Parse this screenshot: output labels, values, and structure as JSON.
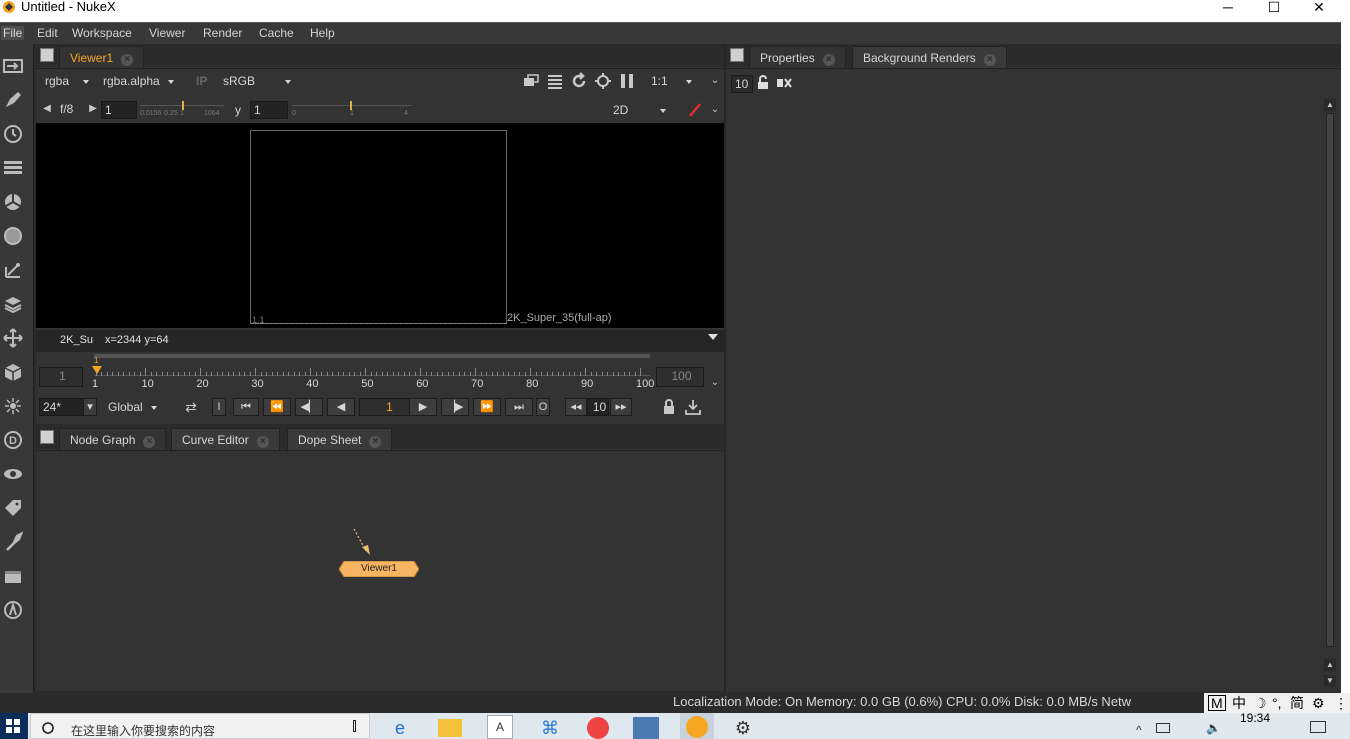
{
  "window": {
    "title": "Untitled - NukeX",
    "minimize": "─",
    "maximize": "☐",
    "close": "✕"
  },
  "menu": [
    "File",
    "Edit",
    "Workspace",
    "Viewer",
    "Render",
    "Cache",
    "Help"
  ],
  "toolbar_icons": [
    "image-icon",
    "draw-icon",
    "time-icon",
    "channel-icon",
    "color-icon",
    "filter-icon",
    "keyer-icon",
    "merge-icon",
    "transform-icon",
    "3d-icon",
    "particles-icon",
    "deep-icon",
    "views-icon",
    "metadata-icon",
    "toolsets-icon",
    "other-icon",
    "furnace-icon"
  ],
  "viewer_panel": {
    "tab": "Viewer1",
    "channels": "rgba",
    "alpha": "rgba.alpha",
    "ip": "IP",
    "lut": "sRGB",
    "zoom": "1:1",
    "fstop": "f/8",
    "gain": "1",
    "gain_ticks": [
      "0.0156",
      "0.25",
      "1",
      "1064"
    ],
    "gamma_label": "y",
    "gamma": "1",
    "gamma_ticks": [
      "0",
      "1",
      "4"
    ],
    "view_mode": "2D",
    "frame_origin": "1,1",
    "format_label": "2K_Super_35(full-ap)",
    "info_format": "2K_Su",
    "info_coords": "x=2344 y=64",
    "timeline": {
      "start": "1",
      "end": "100",
      "ticks": [
        "1",
        "10",
        "20",
        "30",
        "40",
        "50",
        "60",
        "70",
        "80",
        "90",
        "100"
      ],
      "marker": "1",
      "fps": "24*",
      "range_mode": "Global",
      "current_frame": "1",
      "step": "10",
      "in_label": "I",
      "out_label": "O"
    }
  },
  "node_panel": {
    "tabs": [
      "Node Graph",
      "Curve Editor",
      "Dope Sheet"
    ],
    "node_label": "Viewer1"
  },
  "properties_panel": {
    "tabs": [
      "Properties",
      "Background Renders"
    ],
    "max_panels": "10"
  },
  "statusbar": {
    "text": "Localization Mode: On Memory: 0.0 GB (0.6%) CPU: 0.0% Disk: 0.0 MB/s Netw"
  },
  "taskbar": {
    "search_placeholder": "在这里输入你要搜索的内容",
    "time": "19:34",
    "ime": [
      "M",
      "中",
      "简"
    ]
  },
  "colors": {
    "accent": "#f5a623",
    "bg": "#2b2b2b",
    "panel": "#333333",
    "node": "#f7b461"
  }
}
